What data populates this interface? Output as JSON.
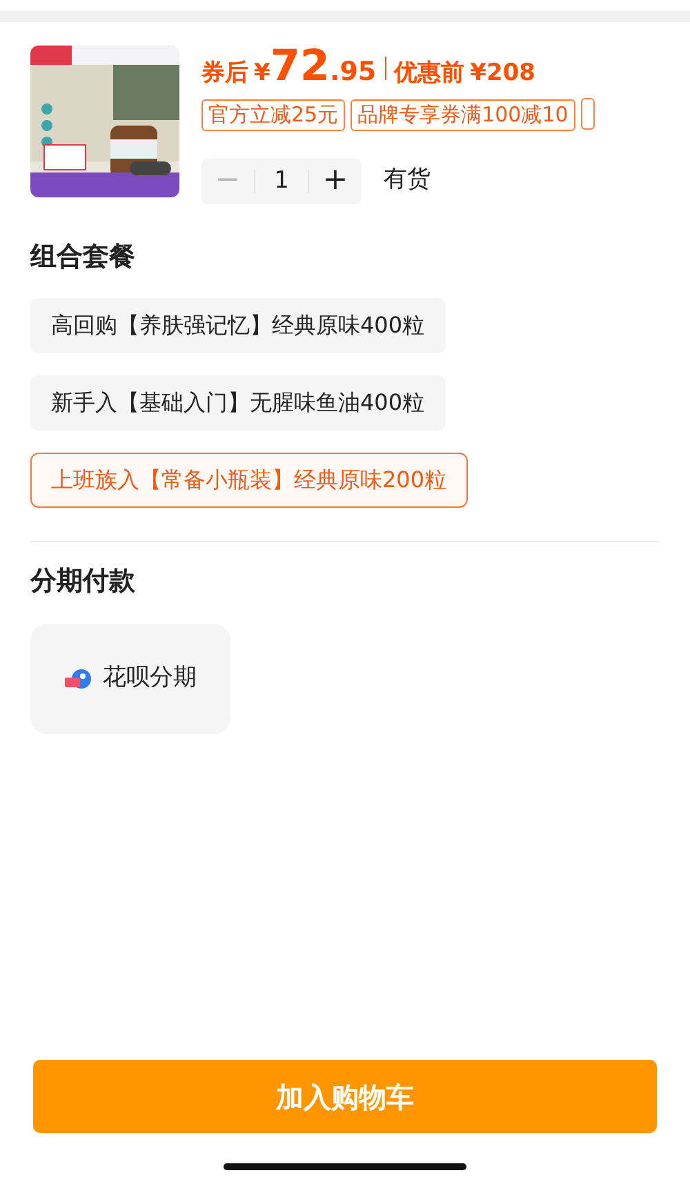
{
  "product": {
    "kind": "picture",
    "price": {
      "label": "券后",
      "currency": "¥",
      "integer": "72",
      "decimal": ".95",
      "original_label": "优惠前",
      "original_price": "¥208"
    },
    "coupons": [
      "官方立减25元",
      "品牌专享券满100减10"
    ],
    "quantity": {
      "minus": "−",
      "value": "1",
      "plus": "+",
      "minus_disabled": true
    },
    "stock": "有货"
  },
  "bundle": {
    "title": "组合套餐",
    "options": [
      {
        "label": "高回购【养肤强记忆】经典原味400粒",
        "selected": false
      },
      {
        "label": "新手入【基础入门】无腥味鱼油400粒",
        "selected": false
      },
      {
        "label": "上班族入【常备小瓶装】经典原味200粒",
        "selected": true
      }
    ]
  },
  "installment": {
    "title": "分期付款",
    "options": [
      {
        "label": "花呗分期",
        "selected": false
      }
    ]
  },
  "add_to_cart": "加入购物车"
}
